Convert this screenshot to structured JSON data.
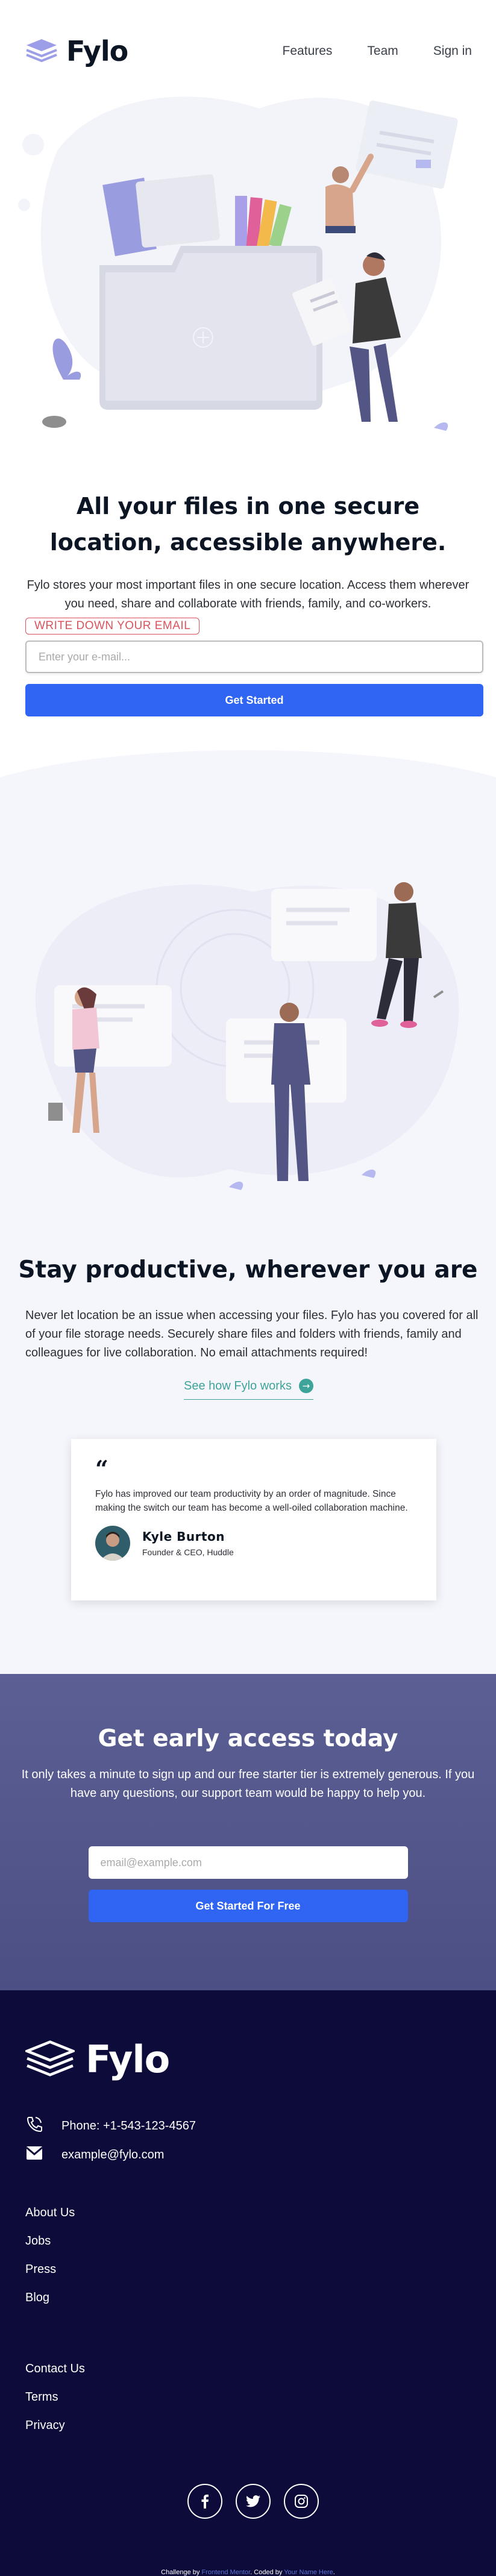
{
  "header": {
    "brand": "Fylo",
    "nav": [
      "Features",
      "Team",
      "Sign in"
    ]
  },
  "hero": {
    "title": "All your files in one secure location, accessible anywhere.",
    "subtitle": "Fylo stores your most important files in one secure location. Access them wherever you need, share and collaborate with friends, family, and co-workers.",
    "error": "WRITE DOWN YOUR EMAIL",
    "input_placeholder": "Enter your e-mail...",
    "button": "Get Started"
  },
  "productive": {
    "title": "Stay productive, wherever you are",
    "text": "Never let location be an issue when accessing your files. Fylo has you covered for all of your file storage needs. Securely share files and folders with friends, family and colleagues for live collaboration. No email attachments required!",
    "link": "See how Fylo works",
    "link_icon": "arrow-right-icon"
  },
  "testimonial": {
    "quote_mark": "“",
    "text": "Fylo has improved our team productivity by an order of magnitude. Since making the switch our team has become a well-oiled collaboration machine.",
    "name": "Kyle Burton",
    "role": "Founder & CEO, Huddle"
  },
  "early_access": {
    "title": "Get early access today",
    "text": "It only takes a minute to sign up and our free starter tier is extremely generous. If you have any questions, our support team would be happy to help you.",
    "input_placeholder": "email@example.com",
    "button": "Get Started For Free"
  },
  "footer": {
    "brand": "Fylo",
    "phone": "Phone: +1-543-123-4567",
    "email": "example@fylo.com",
    "links_1": [
      "About Us",
      "Jobs",
      "Press",
      "Blog"
    ],
    "links_2": [
      "Contact Us",
      "Terms",
      "Privacy"
    ],
    "socials": [
      "facebook-icon",
      "twitter-icon",
      "instagram-icon"
    ],
    "attribution": {
      "prefix": "Challenge by",
      "source": "Frontend Mentor",
      "middle": ". Coded by",
      "author": "Your Name Here",
      "suffix": "."
    }
  },
  "colors": {
    "accent": "#3064f2",
    "teal": "#3ea398",
    "error": "#d9535d",
    "early_bg": "#5b5f93",
    "footer_bg": "#0c0b3a"
  }
}
